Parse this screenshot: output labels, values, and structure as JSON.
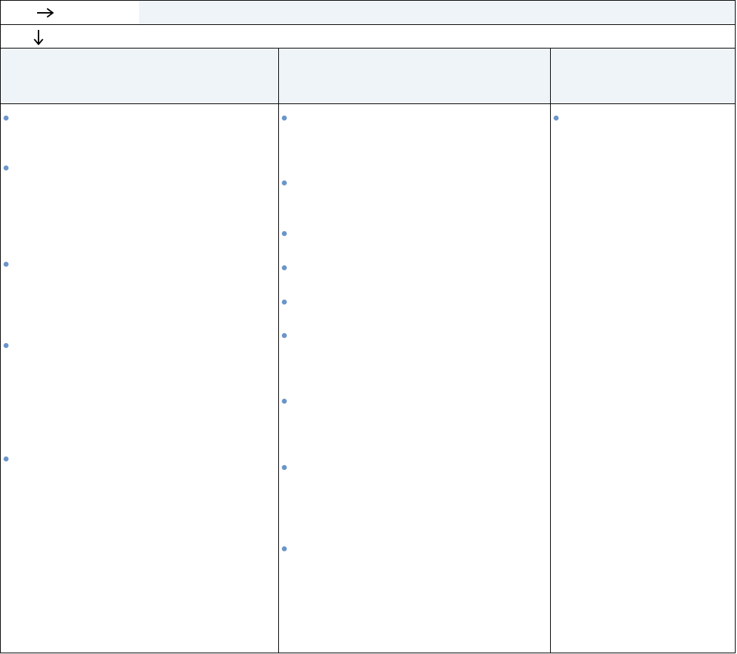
{
  "icons": {
    "right_arrow": "arrow-right-icon",
    "down_arrow": "arrow-down-icon"
  },
  "colors": {
    "bullet": "#6b95c8",
    "header_fill": "#eff4f9",
    "border": "#000000"
  },
  "columns": [
    {
      "header": "",
      "bullet_count": 5
    },
    {
      "header": "",
      "bullet_count": 9
    },
    {
      "header": "",
      "bullet_count": 1
    }
  ]
}
